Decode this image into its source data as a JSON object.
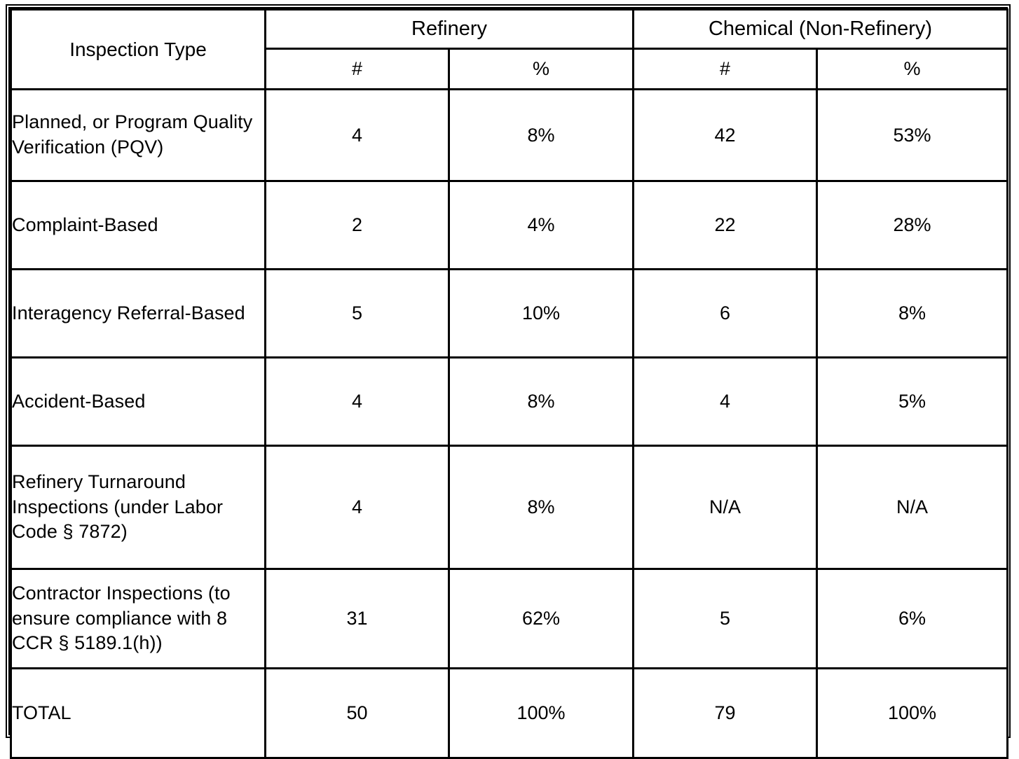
{
  "table": {
    "row_header_label": "Inspection Type",
    "groups": [
      {
        "label": "Refinery"
      },
      {
        "label": "Chemical (Non-Refinery)"
      }
    ],
    "subheaders": {
      "refinery_count": "#",
      "refinery_pct": "%",
      "chemical_count": "#",
      "chemical_pct": "%"
    },
    "rows": [
      {
        "type": "Planned, or Program Quality Verification (PQV)",
        "refinery_count": "4",
        "refinery_pct": "8%",
        "chemical_count": "42",
        "chemical_pct": "53%"
      },
      {
        "type": "Complaint-Based",
        "refinery_count": "2",
        "refinery_pct": "4%",
        "chemical_count": "22",
        "chemical_pct": "28%"
      },
      {
        "type": "Interagency Referral-Based",
        "refinery_count": "5",
        "refinery_pct": "10%",
        "chemical_count": "6",
        "chemical_pct": "8%"
      },
      {
        "type": "Accident-Based",
        "refinery_count": "4",
        "refinery_pct": "8%",
        "chemical_count": "4",
        "chemical_pct": "5%"
      },
      {
        "type": "Refinery Turnaround Inspections (under Labor Code § 7872)",
        "refinery_count": "4",
        "refinery_pct": "8%",
        "chemical_count": "N/A",
        "chemical_pct": "N/A"
      },
      {
        "type": "Contractor Inspections (to ensure compliance with 8 CCR § 5189.1(h))",
        "refinery_count": "31",
        "refinery_pct": "62%",
        "chemical_count": "5",
        "chemical_pct": "6%"
      }
    ],
    "total": {
      "label": "TOTAL",
      "refinery_count": "50",
      "refinery_pct": "100%",
      "chemical_count": "79",
      "chemical_pct": "100%"
    }
  },
  "chart_data": {
    "type": "table",
    "title": "Inspection Type counts and percentages by facility category",
    "columns": [
      "Inspection Type",
      "Refinery #",
      "Refinery %",
      "Chemical (Non-Refinery) #",
      "Chemical (Non-Refinery) %"
    ],
    "rows": [
      [
        "Planned, or Program Quality Verification (PQV)",
        4,
        "8%",
        42,
        "53%"
      ],
      [
        "Complaint-Based",
        2,
        "4%",
        22,
        "28%"
      ],
      [
        "Interagency Referral-Based",
        5,
        "10%",
        6,
        "8%"
      ],
      [
        "Accident-Based",
        4,
        "8%",
        4,
        "5%"
      ],
      [
        "Refinery Turnaround Inspections (under Labor Code § 7872)",
        4,
        "8%",
        "N/A",
        "N/A"
      ],
      [
        "Contractor Inspections (to ensure compliance with 8 CCR § 5189.1(h))",
        31,
        "62%",
        5,
        "6%"
      ],
      [
        "TOTAL",
        50,
        "100%",
        79,
        "100%"
      ]
    ]
  }
}
